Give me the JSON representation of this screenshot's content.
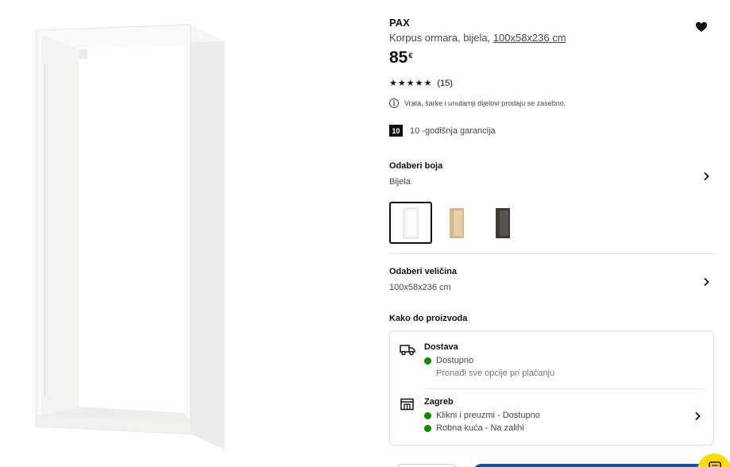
{
  "product": {
    "name": "PAX",
    "description_prefix": "Korpus ormara, bijela, ",
    "description_size": "100x58x236 cm",
    "price_value": "85",
    "price_currency": "€",
    "stars": "★★★★★",
    "rating_count": "(15)",
    "notice": "Vrata, šarke i unutarnji dijelovi prodaju se zasebno.",
    "warranty_badge": "10",
    "warranty_text": "10 -godišnja garancija"
  },
  "color_select": {
    "title": "Odaberi boja",
    "selected": "Bijela",
    "swatches": [
      {
        "name": "white",
        "color": "#f4f4f2"
      },
      {
        "name": "oak",
        "color": "#d6b98c"
      },
      {
        "name": "black-brown",
        "color": "#3d3b38"
      }
    ]
  },
  "size_select": {
    "title": "Odaberi veličina",
    "selected": "100x58x236 cm"
  },
  "availability": {
    "title": "Kako do proizvoda",
    "delivery": {
      "title": "Dostava",
      "status": "Dostupno",
      "note": "Pronađi sve opcije pri plaćanju"
    },
    "store": {
      "name": "Zagreb",
      "status_pickup": "Klikni i preuzmi - Dostupno",
      "status_stock": "Robna kuća - Na zalihi"
    }
  },
  "colors": {
    "accent": "#0058a3",
    "available": "#0a8a00",
    "chat": "#ffdb00"
  },
  "icons": {
    "favourite": "heart-icon",
    "info": "info-icon",
    "delivery": "truck-icon",
    "store": "store-icon",
    "chevron": "chevron-right-icon",
    "chat": "chat-icon"
  }
}
